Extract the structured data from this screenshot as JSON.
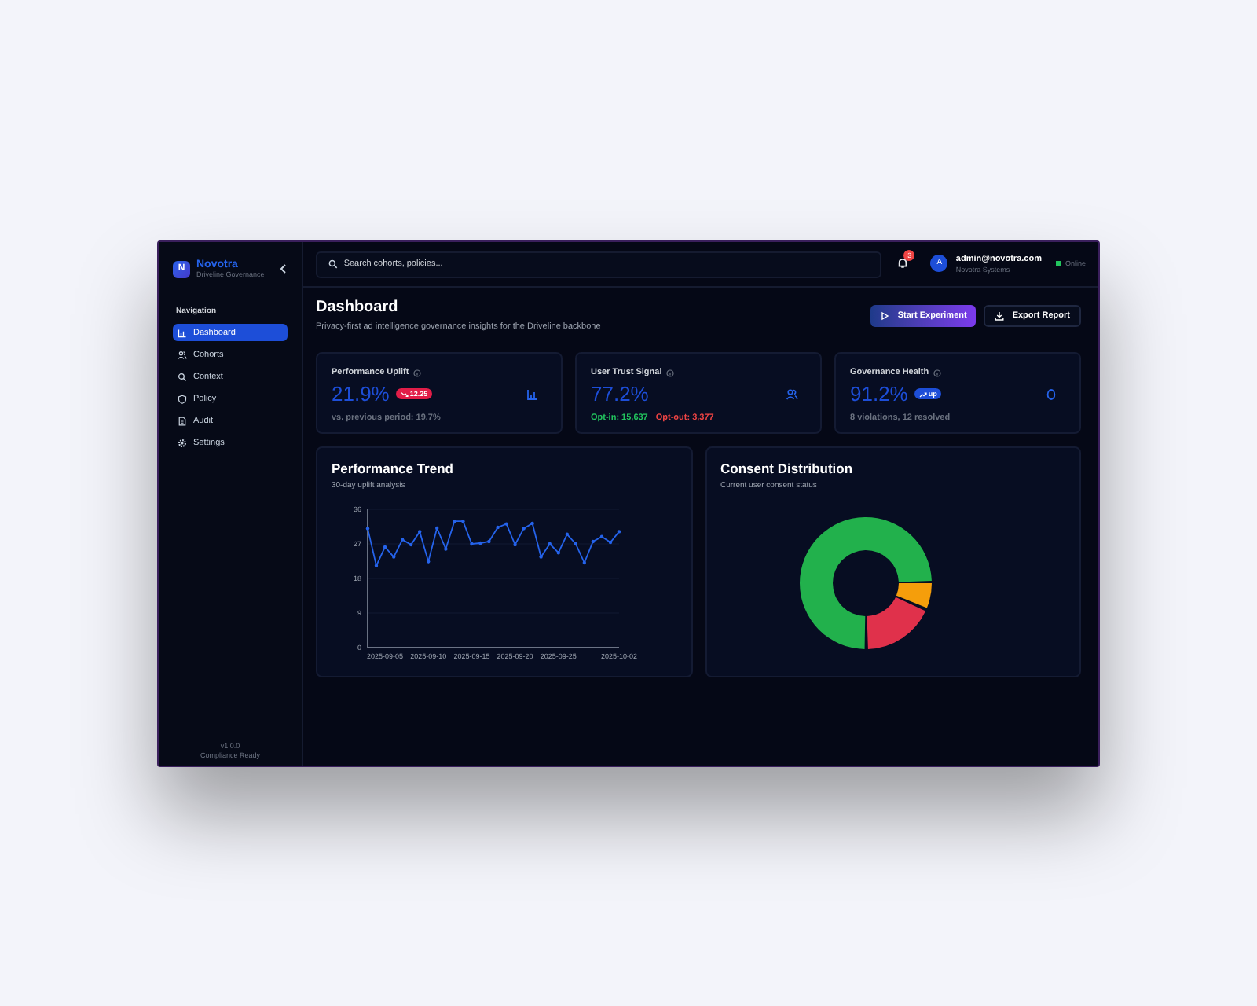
{
  "brand": {
    "name": "Novotra",
    "subtitle": "Driveline Governance",
    "logo_letter": "N"
  },
  "sidebar": {
    "heading": "Navigation",
    "items": [
      {
        "label": "Dashboard",
        "selected": true
      },
      {
        "label": "Cohorts",
        "selected": false
      },
      {
        "label": "Context",
        "selected": false
      },
      {
        "label": "Policy",
        "selected": false
      },
      {
        "label": "Audit",
        "selected": false
      },
      {
        "label": "Settings",
        "selected": false
      }
    ],
    "footer": [
      "v1.0.0",
      "Compliance Ready"
    ]
  },
  "topbar": {
    "search": {
      "placeholder": "Search cohorts, policies..."
    },
    "notifications": "3",
    "user": {
      "avatar_letter": "A",
      "email": "admin@novotra.com",
      "org": "Novotra Systems",
      "status": "Online"
    }
  },
  "header": {
    "title": "Dashboard",
    "subtitle": "Privacy-first ad intelligence governance insights for the Driveline backbone",
    "buttons": [
      {
        "label": "Start Experiment",
        "kind": "primary"
      },
      {
        "label": "Export Report",
        "kind": "secondary"
      }
    ]
  },
  "cards": [
    {
      "title": "Performance Uplift",
      "value": "21.9%",
      "badge": {
        "text": "12.25",
        "color": "#e11d48"
      },
      "foot": [
        {
          "text": "vs. previous period: 19.7%",
          "color": "#6b7280"
        }
      ]
    },
    {
      "title": "User Trust Signal",
      "value": "77.2%",
      "foot": [
        {
          "text": "Opt-in: 15,637",
          "color": "#22c55e"
        },
        {
          "text": "Opt-out: 3,377",
          "color": "#ef4444"
        }
      ]
    },
    {
      "title": "Governance Health",
      "value": "91.2%",
      "badge": {
        "text": "up",
        "color": "#1d4ed8"
      },
      "foot": [
        {
          "text": "8 violations, 12 resolved",
          "color": "#6b7280"
        }
      ]
    }
  ],
  "trend_panel": {
    "title": "Performance Trend",
    "subtitle": "30-day uplift analysis",
    "chart_data": {
      "type": "line",
      "grid": true,
      "categories": [
        null,
        null,
        "2025-09-05",
        null,
        null,
        null,
        null,
        "2025-09-10",
        null,
        null,
        null,
        null,
        "2025-09-15",
        null,
        null,
        null,
        null,
        "2025-09-20",
        null,
        null,
        null,
        null,
        "2025-09-25",
        null,
        null,
        null,
        null,
        null,
        null,
        "2025-10-02"
      ],
      "series": [
        {
          "color": "#2563eb",
          "values": [
            31.0,
            21.3,
            26.2,
            23.6,
            28.1,
            26.8,
            30.2,
            22.4,
            31.1,
            25.7,
            32.9,
            32.9,
            27.0,
            27.2,
            27.6,
            31.3,
            32.2,
            26.8,
            31.0,
            32.3,
            23.6,
            27.0,
            24.7,
            29.5,
            27.0,
            22.1,
            27.6,
            28.9,
            27.4,
            30.2
          ]
        }
      ],
      "ylim": [
        0,
        36
      ],
      "yticks": [
        0,
        9,
        18,
        27,
        36
      ]
    }
  },
  "consent_panel": {
    "title": "Consent Distribution",
    "subtitle": "Current user consent status"
  }
}
